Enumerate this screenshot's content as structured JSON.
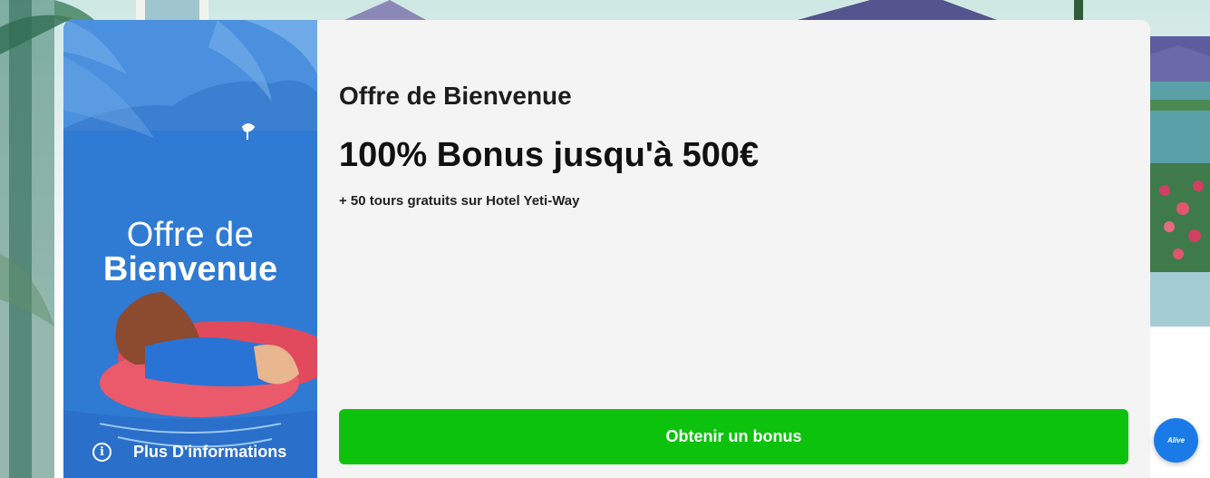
{
  "promo_art": {
    "title_line1": "Offre de",
    "title_line2": "Bienvenue",
    "info_label": "Plus D'informations",
    "info_icon_glyph": "i"
  },
  "offer": {
    "heading": "Offre de Bienvenue",
    "amount": "100% Bonus jusqu'à 500€",
    "extra": "+ 50 tours gratuits sur Hotel Yeti-Way"
  },
  "cta": {
    "label": "Obtenir un bonus"
  },
  "chat_widget": {
    "logo_text": "Alive"
  },
  "colors": {
    "cta_green": "#0dc20d",
    "art_blue": "#2f7fd6",
    "card_bg": "#f4f4f4",
    "chat_blue": "#1a7be8"
  }
}
